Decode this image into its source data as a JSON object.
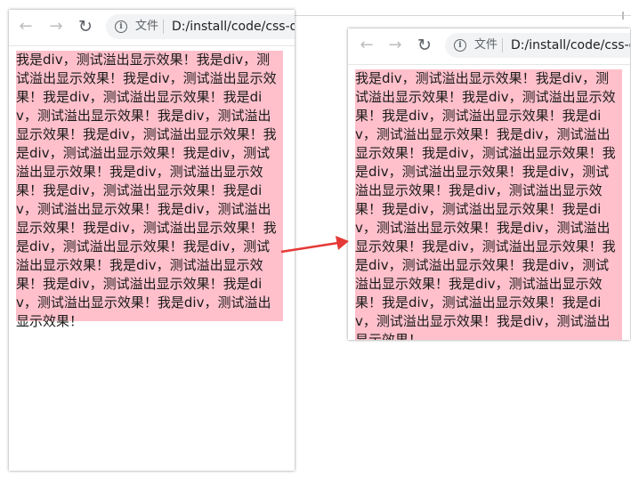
{
  "browser": {
    "back_glyph": "←",
    "forward_glyph": "→",
    "reload_glyph": "↻",
    "info_glyph": "i",
    "scheme_label": "文件",
    "url": "D:/install/code/css-demo"
  },
  "content": {
    "div_text": "我是div，测试溢出显示效果！我是div，测试溢出显示效果！我是div，测试溢出显示效果！我是div，测试溢出显示效果！我是div，测试溢出显示效果！我是div，测试溢出显示效果！我是div，测试溢出显示效果！我是div，测试溢出显示效果！我是div，测试溢出显示效果！我是div，测试溢出显示效果！我是div，测试溢出显示效果！我是div，测试溢出显示效果！我是div，测试溢出显示效果！我是div，测试溢出显示效果！我是div，测试溢出显示效果！我是div，测试溢出显示效果！我是div，测试溢出显示效果！我是div，测试溢出显示效果！我是div，测试溢出显示效果！我是div，测试溢出显示效果！"
  },
  "colors": {
    "div_background": "#ffc0cb",
    "arrow": "#e53935"
  },
  "icons": [
    "back-arrow-icon",
    "forward-arrow-icon",
    "reload-icon",
    "info-icon",
    "arrow-annotation"
  ]
}
